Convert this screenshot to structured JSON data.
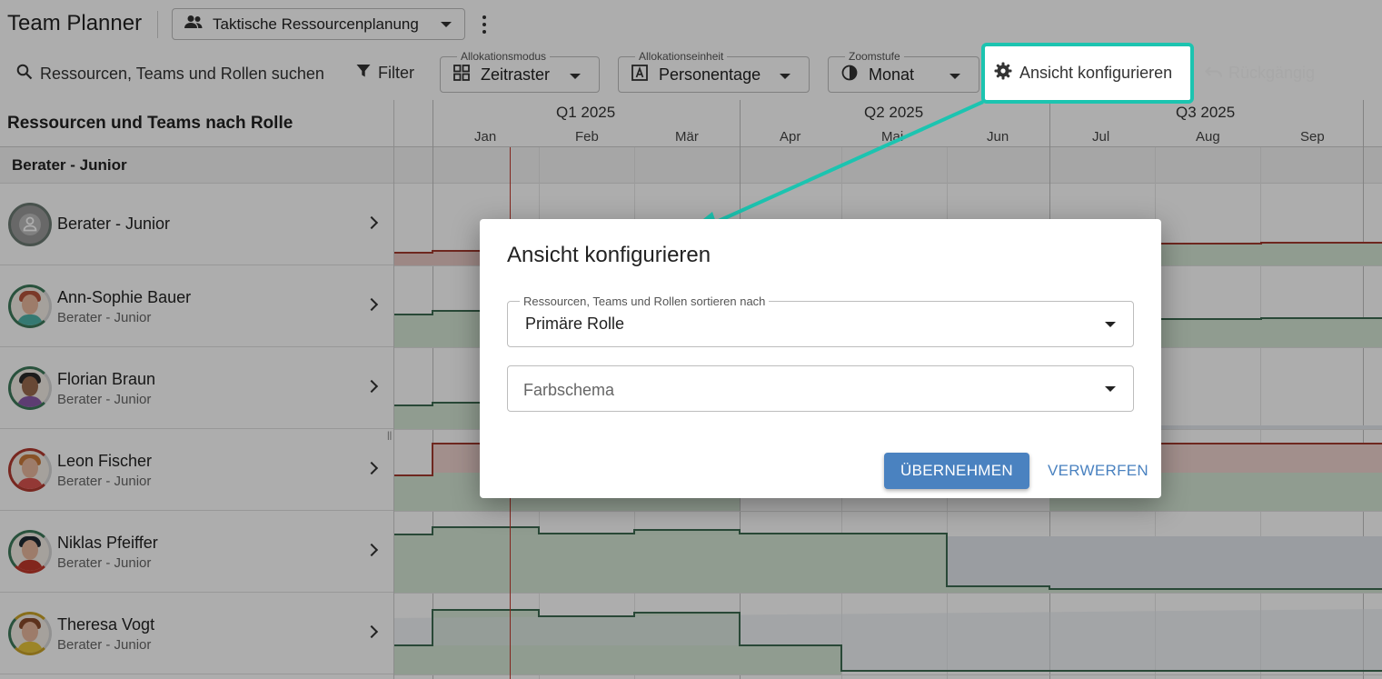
{
  "app": {
    "title": "Team Planner"
  },
  "plan_select": {
    "value": "Taktische Ressourcenplanung",
    "icon": "people-icon"
  },
  "toolbar": {
    "search_label": "Ressourcen, Teams und Rollen suchen",
    "filter_label": "Filter",
    "mode": {
      "legend": "Allokationsmodus",
      "value": "Zeitraster"
    },
    "unit": {
      "legend": "Allokationseinheit",
      "value": "Personentage"
    },
    "zoom": {
      "legend": "Zoomstufe",
      "value": "Monat"
    },
    "configure_label": "Ansicht konfigurieren",
    "undo_label": "Rückgängig",
    "highlight_color": "#1cc4b0"
  },
  "left_panel": {
    "header": "Ressourcen und Teams nach Rolle",
    "group": "Berater - Junior",
    "rows": [
      {
        "name": "Berater - Junior",
        "role": ""
      },
      {
        "name": "Ann-Sophie Bauer",
        "role": "Berater - Junior"
      },
      {
        "name": "Florian Braun",
        "role": "Berater - Junior"
      },
      {
        "name": "Leon Fischer",
        "role": "Berater - Junior"
      },
      {
        "name": "Niklas Pfeiffer",
        "role": "Berater - Junior"
      },
      {
        "name": "Theresa Vogt",
        "role": "Berater - Junior"
      }
    ]
  },
  "timeline": {
    "quarters": [
      "Q1 2025",
      "Q2 2025",
      "Q3 2025"
    ],
    "months": [
      "Jan",
      "Feb",
      "Mär",
      "Apr",
      "Mai",
      "Jun",
      "Jul",
      "Aug",
      "Sep"
    ]
  },
  "dialog": {
    "title": "Ansicht konfigurieren",
    "sort_legend": "Ressourcen, Teams und Rollen sortieren nach",
    "sort_value": "Primäre Rolle",
    "scheme_placeholder": "Farbschema",
    "apply_label": "ÜBERNEHMEN",
    "discard_label": "VERWERFEN",
    "accent_color": "#4a82c0"
  }
}
